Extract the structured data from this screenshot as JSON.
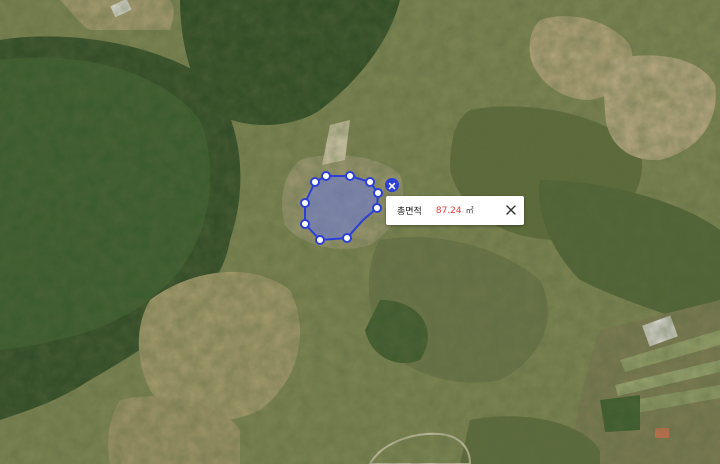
{
  "measure_popup": {
    "label": "총면적",
    "value": "87.24",
    "unit": "㎡"
  },
  "colors": {
    "polygon_stroke": "#2b3fd6",
    "polygon_fill": "#6b7ad8",
    "value_text": "#e43a3a",
    "delete_button": "#2b3fd6"
  },
  "icons": {
    "close": "close-icon",
    "delete": "delete-polygon-icon",
    "vertex": "vertex-handle"
  }
}
